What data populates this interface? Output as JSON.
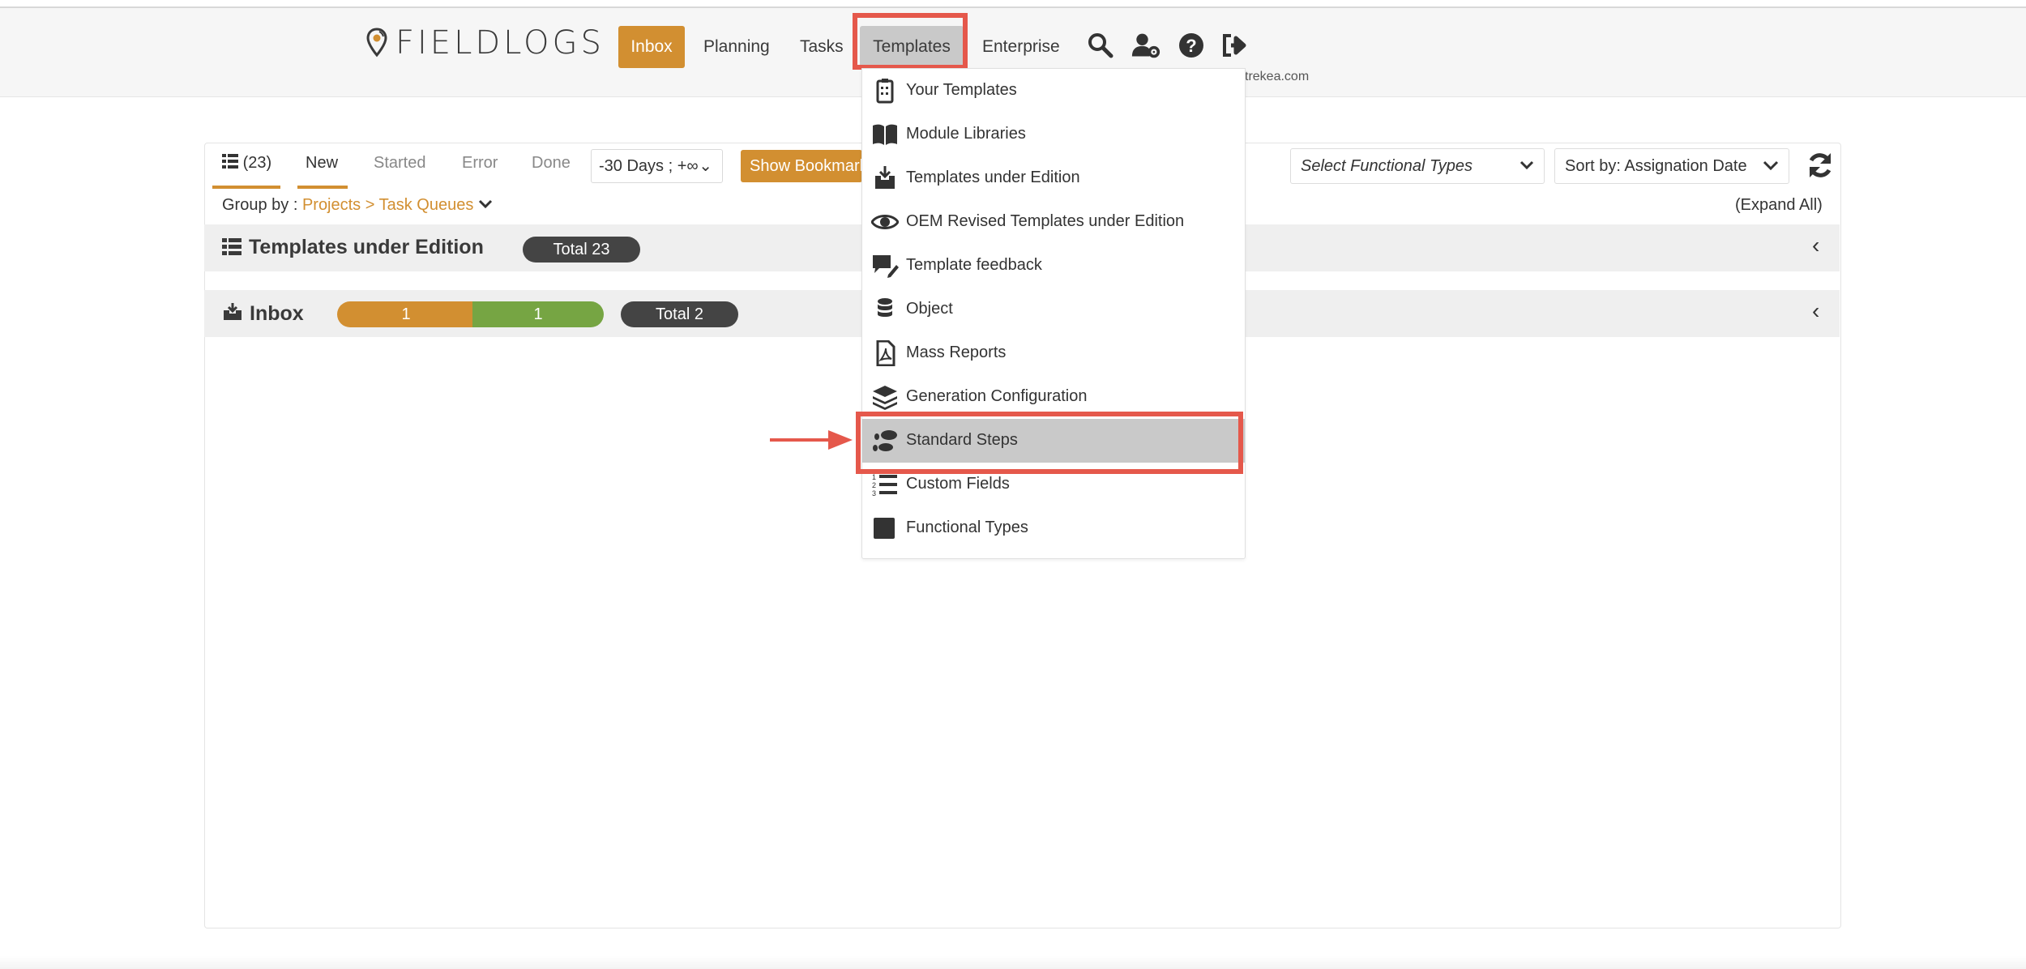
{
  "header": {
    "logo_text": "FIELDLOGS",
    "nav": {
      "inbox": "Inbox",
      "planning": "Planning",
      "tasks": "Tasks",
      "templates": "Templates",
      "enterprise": "Enterprise"
    },
    "email_fragment": "trekea.com",
    "icons": [
      "search-icon",
      "user-settings-icon",
      "help-icon",
      "logout-icon"
    ]
  },
  "toolbar": {
    "count": "(23)",
    "tabs": {
      "new": "New",
      "started": "Started",
      "error": "Error",
      "done": "Done"
    },
    "date_range": "-30 Days ; +∞",
    "bookmark_button": "Show Bookmarks",
    "functional_types_placeholder": "Select Functional Types",
    "sort": "Sort by: Assignation Date"
  },
  "groupby": {
    "label": "Group by : ",
    "value": "Projects > Task Queues",
    "expand_all": "(Expand All)"
  },
  "sections": {
    "templates": {
      "title": "Templates under Edition",
      "total": "Total 23"
    },
    "inbox": {
      "title": "Inbox",
      "seg1": "1",
      "seg2": "1",
      "total": "Total 2"
    }
  },
  "dropdown": {
    "items": [
      "Your Templates",
      "Module Libraries",
      "Templates under Edition",
      "OEM Revised Templates under Edition",
      "Template feedback",
      "Object",
      "Mass Reports",
      "Generation Configuration",
      "Standard Steps",
      "Custom Fields",
      "Functional Types"
    ],
    "highlighted": "Standard Steps"
  },
  "colors": {
    "accent": "#d28f31",
    "highlight_box": "#e5584b",
    "green": "#76a543",
    "dark_pill": "#444444"
  }
}
